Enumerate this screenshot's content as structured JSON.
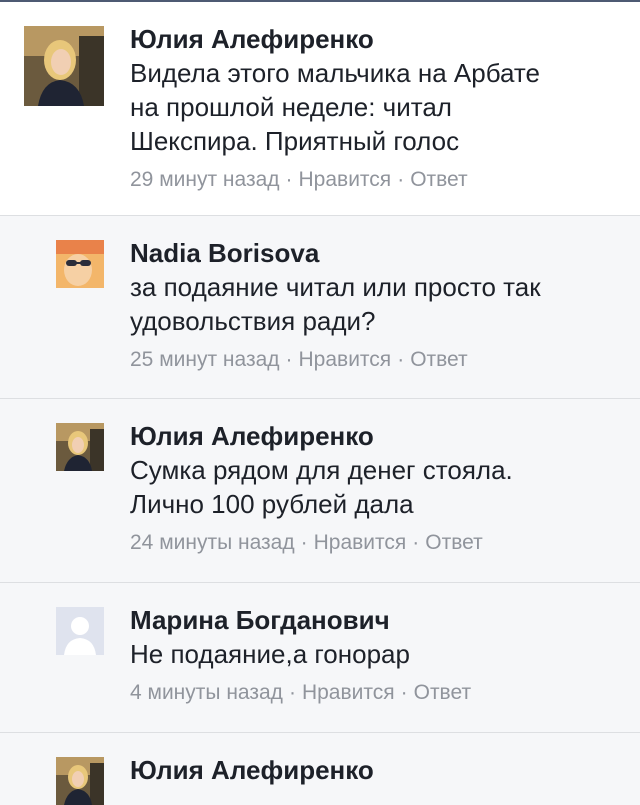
{
  "comments": [
    {
      "author": "Юлия Алефиренко",
      "text": [
        "Видела этого мальчика на Арбате",
        "на прошлой неделе: читал",
        "Шекспира. Приятный голос"
      ],
      "time": "29 минут назад",
      "like": "Нравится",
      "reply": "Ответ",
      "separator": "·",
      "avatar": "avatar-photo-woman-blonde"
    },
    {
      "author": "Nadia Borisova",
      "text": [
        "за подаяние читал или просто так",
        "удовольствия ради?"
      ],
      "time": "25 минут назад",
      "like": "Нравится",
      "reply": "Ответ",
      "separator": "·",
      "avatar": "avatar-photo-woman-sunglasses"
    },
    {
      "author": "Юлия Алефиренко",
      "text": [
        "Сумка рядом для денег стояла.",
        "Лично 100 рублей дала"
      ],
      "time": "24 минуты назад",
      "like": "Нравится",
      "reply": "Ответ",
      "separator": "·",
      "avatar": "avatar-photo-woman-blonde"
    },
    {
      "author": "Марина Богданович",
      "text": [
        "Не подаяние,а гонорар"
      ],
      "time": "4 минуты назад",
      "like": "Нравится",
      "reply": "Ответ",
      "separator": "·",
      "avatar": "avatar-placeholder-silhouette"
    },
    {
      "author": "Юлия Алефиренко",
      "text": [],
      "avatar": "avatar-photo-woman-blonde"
    }
  ],
  "colors": {
    "text": "#1d2129",
    "meta": "#90949c",
    "divider": "#dddfe2",
    "reply_background": "#f6f7f9"
  }
}
